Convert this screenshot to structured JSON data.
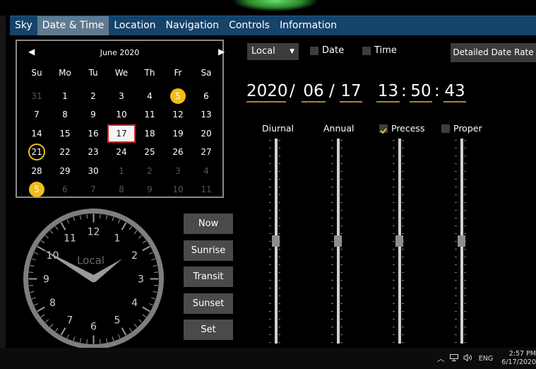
{
  "menu": [
    "Sky",
    "Date & Time",
    "Location",
    "Navigation",
    "Controls",
    "Information"
  ],
  "menu_active": "Date & Time",
  "calendar": {
    "month_label": "June 2020",
    "prev_icon": "chevron-left-icon",
    "next_icon": "chevron-right-icon",
    "weekdays": [
      "Su",
      "Mo",
      "Tu",
      "We",
      "Th",
      "Fr",
      "Sa"
    ],
    "weeks": [
      [
        {
          "d": "31",
          "dim": true
        },
        {
          "d": "1"
        },
        {
          "d": "2"
        },
        {
          "d": "3"
        },
        {
          "d": "4"
        },
        {
          "d": "5",
          "dot": true
        },
        {
          "d": "6"
        }
      ],
      [
        {
          "d": "7"
        },
        {
          "d": "8"
        },
        {
          "d": "9"
        },
        {
          "d": "10"
        },
        {
          "d": "11"
        },
        {
          "d": "12"
        },
        {
          "d": "13"
        }
      ],
      [
        {
          "d": "14"
        },
        {
          "d": "15"
        },
        {
          "d": "16"
        },
        {
          "d": "17",
          "selected": true
        },
        {
          "d": "18"
        },
        {
          "d": "19"
        },
        {
          "d": "20"
        }
      ],
      [
        {
          "d": "21",
          "ring": true
        },
        {
          "d": "22"
        },
        {
          "d": "23"
        },
        {
          "d": "24"
        },
        {
          "d": "25"
        },
        {
          "d": "26"
        },
        {
          "d": "27"
        }
      ],
      [
        {
          "d": "28"
        },
        {
          "d": "29"
        },
        {
          "d": "30"
        },
        {
          "d": "1",
          "dim": true
        },
        {
          "d": "2",
          "dim": true
        },
        {
          "d": "3",
          "dim": true
        },
        {
          "d": "4",
          "dim": true
        }
      ],
      [
        {
          "d": "5",
          "dim": true,
          "dot": true
        },
        {
          "d": "6",
          "dim": true
        },
        {
          "d": "7",
          "dim": true
        },
        {
          "d": "8",
          "dim": true
        },
        {
          "d": "9",
          "dim": true
        },
        {
          "d": "10",
          "dim": true
        },
        {
          "d": "11",
          "dim": true
        }
      ]
    ]
  },
  "clock": {
    "label": "Local",
    "numbers": [
      "12",
      "1",
      "2",
      "3",
      "4",
      "5",
      "6",
      "7",
      "8",
      "9",
      "10",
      "11"
    ],
    "hour": 13,
    "minute": 50
  },
  "buttons": [
    "Now",
    "Sunrise",
    "Transit",
    "Sunset",
    "Set"
  ],
  "timezone_select": "Local",
  "checkboxes": [
    {
      "label": "Date",
      "checked": false
    },
    {
      "label": "Time",
      "checked": false
    }
  ],
  "detail_button": "Detailed Date Rate",
  "datetime": {
    "year": "2020",
    "month": "06",
    "day": "17",
    "hour": "13",
    "minute": "50",
    "second": "43",
    "date_sep": "/",
    "time_sep": ":"
  },
  "sliders": [
    {
      "label": "Diurnal",
      "has_checkbox": false,
      "checked": false,
      "position": 0.5
    },
    {
      "label": "Annual",
      "has_checkbox": false,
      "checked": false,
      "position": 0.5
    },
    {
      "label": "Precess",
      "has_checkbox": true,
      "checked": true,
      "position": 0.5
    },
    {
      "label": "Proper",
      "has_checkbox": true,
      "checked": false,
      "position": 0.5
    }
  ],
  "taskbar": {
    "language": "ENG",
    "time": "2:57 PM",
    "date": "6/17/2020",
    "icons": [
      "chevron-up-icon",
      "network-icon",
      "volume-icon"
    ]
  },
  "colors": {
    "accent": "#f2be16",
    "menubar": "#16436a",
    "selected_border": "#cc2a2a",
    "underline": "#b0841e",
    "checkmark": "#f2be16"
  }
}
